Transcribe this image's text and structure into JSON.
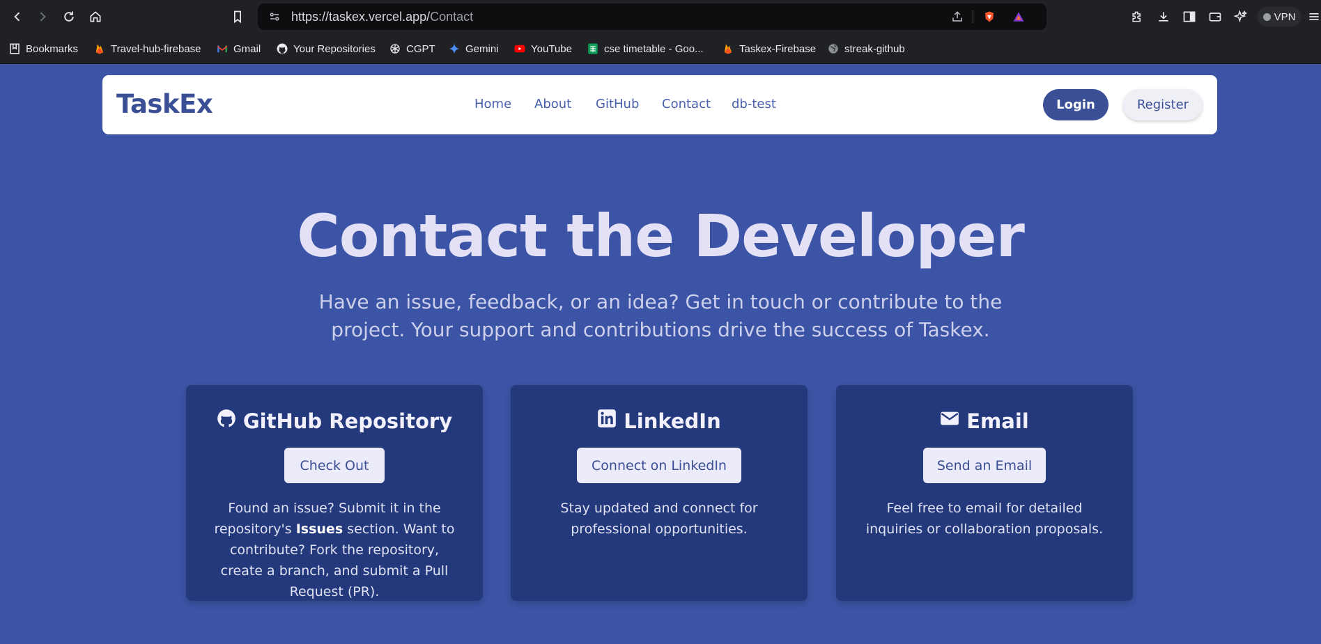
{
  "browser": {
    "url_host": "https://taskex.vercel.app/",
    "url_path": "Contact",
    "vpn_label": "VPN"
  },
  "bookmarks": [
    {
      "label": "Bookmarks",
      "icon": "bookmarks-icon"
    },
    {
      "label": "Travel-hub-firebase",
      "icon": "firebase-icon"
    },
    {
      "label": "Gmail",
      "icon": "gmail-icon"
    },
    {
      "label": "Your Repositories",
      "icon": "github-icon"
    },
    {
      "label": "CGPT",
      "icon": "chatgpt-icon"
    },
    {
      "label": "Gemini",
      "icon": "gemini-icon"
    },
    {
      "label": "YouTube",
      "icon": "youtube-icon"
    },
    {
      "label": "cse timetable - Goo...",
      "icon": "sheets-icon"
    },
    {
      "label": "Taskex-Firebase",
      "icon": "firebase-icon"
    },
    {
      "label": "streak-github",
      "icon": "globe-icon"
    }
  ],
  "site": {
    "logo": "TaskEx",
    "nav": [
      "Home",
      "About",
      "GitHub",
      "Contact",
      "db-test"
    ],
    "login": "Login",
    "register": "Register"
  },
  "hero": {
    "title": "Contact the Developer",
    "subtitle_line1": "Have an issue, feedback, or an idea? Get in touch or contribute to the",
    "subtitle_line2": "project. Your support and contributions drive the success of Taskex."
  },
  "cards": [
    {
      "title": "GitHub Repository",
      "icon": "github-icon",
      "button": "Check Out",
      "text_pre": "Found an issue? Submit it in the repository's ",
      "text_bold": "Issues",
      "text_post": " section. Want to contribute? Fork the repository, create a branch, and submit a Pull Request (PR)."
    },
    {
      "title": "LinkedIn",
      "icon": "linkedin-icon",
      "button": "Connect on LinkedIn",
      "text": "Stay updated and connect for professional opportunities."
    },
    {
      "title": "Email",
      "icon": "envelope-icon",
      "button": "Send an Email",
      "text": "Feel free to email for detailed inquiries or collaboration proposals."
    }
  ],
  "colors": {
    "page_bg": "#3c54a5",
    "card_bg": "#23397c",
    "brand": "#3b4f97",
    "chrome_bg": "#202124"
  }
}
